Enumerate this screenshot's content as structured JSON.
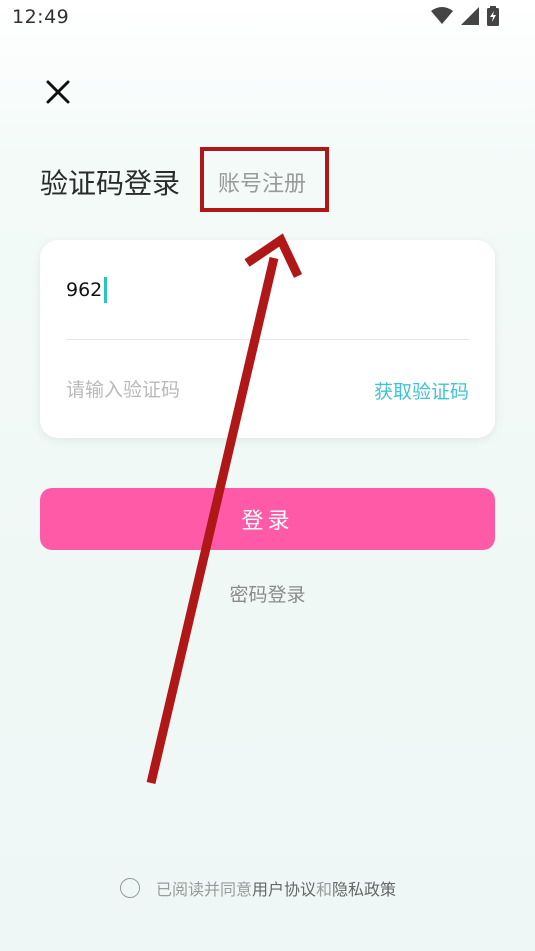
{
  "status_bar": {
    "time": "12:49",
    "icons": [
      "wifi-icon",
      "cellular-signal-icon",
      "battery-charging-icon"
    ]
  },
  "header": {
    "close_icon": "close-icon"
  },
  "tabs": {
    "active_label": "验证码登录",
    "inactive_label": "账号注册"
  },
  "form": {
    "phone_value": "962",
    "code_placeholder": "请输入验证码",
    "get_code_label": "获取验证码"
  },
  "login_button_label": "登录",
  "password_login_label": "密码登录",
  "agreement": {
    "prefix": "已阅读并同意",
    "user_agreement": "用户协议",
    "conjunction": "和",
    "privacy_policy": "隐私政策"
  },
  "colors": {
    "primary_pink": "#ff5aa8",
    "accent_teal": "#3fc3d6",
    "caret": "#28c6c0",
    "annotation_red": "#b01818"
  }
}
